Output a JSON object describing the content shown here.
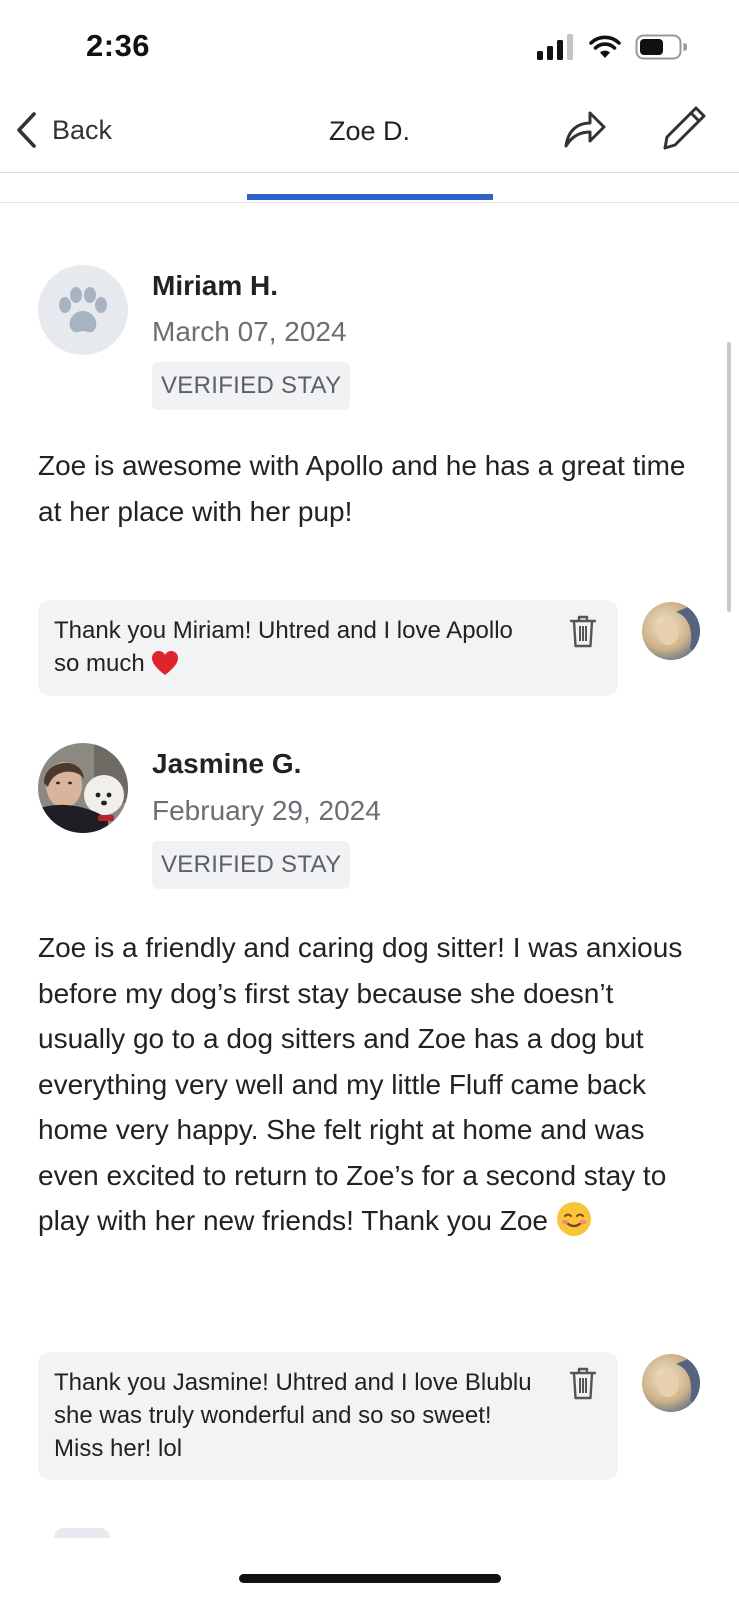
{
  "status_bar": {
    "time": "2:36",
    "icons": [
      "signal-icon",
      "wifi-icon",
      "battery-icon"
    ]
  },
  "nav": {
    "back_label": "Back",
    "title": "Zoe D."
  },
  "colors": {
    "accent": "#2d62c7",
    "badge_bg": "#f1f2f4",
    "reply_bg": "#f2f3f5",
    "date_text": "#6b6f75"
  },
  "reviews": [
    {
      "name": "Miriam H.",
      "date": "March 07, 2024",
      "badge": "VERIFIED STAY",
      "avatar": "paw-icon",
      "text": "Zoe is awesome with Apollo and he has a great time at her place with her pup!",
      "reply": {
        "text": "Thank you Miriam! Uhtred and I love Apollo so much",
        "emoji": "red-heart"
      }
    },
    {
      "name": "Jasmine G.",
      "date": "February 29, 2024",
      "badge": "VERIFIED STAY",
      "avatar": "user-photo",
      "text_main": "Zoe is a friendly and caring dog sitter! I was anxious before my dog’s first stay because she doesn’t usually go to a dog sitters and Zoe has a dog but everything very well and my little Fluff came back home very happy. She felt right at home and was even excited to return to Zoe’s for a second stay to play with her new friends!",
      "text_end": "Thank you Zoe",
      "text_emoji": "smiling-face",
      "reply": {
        "text": "Thank you Jasmine! Uhtred and I love Blublu she was truly wonderful and so so sweet! Miss her! lol"
      }
    }
  ]
}
